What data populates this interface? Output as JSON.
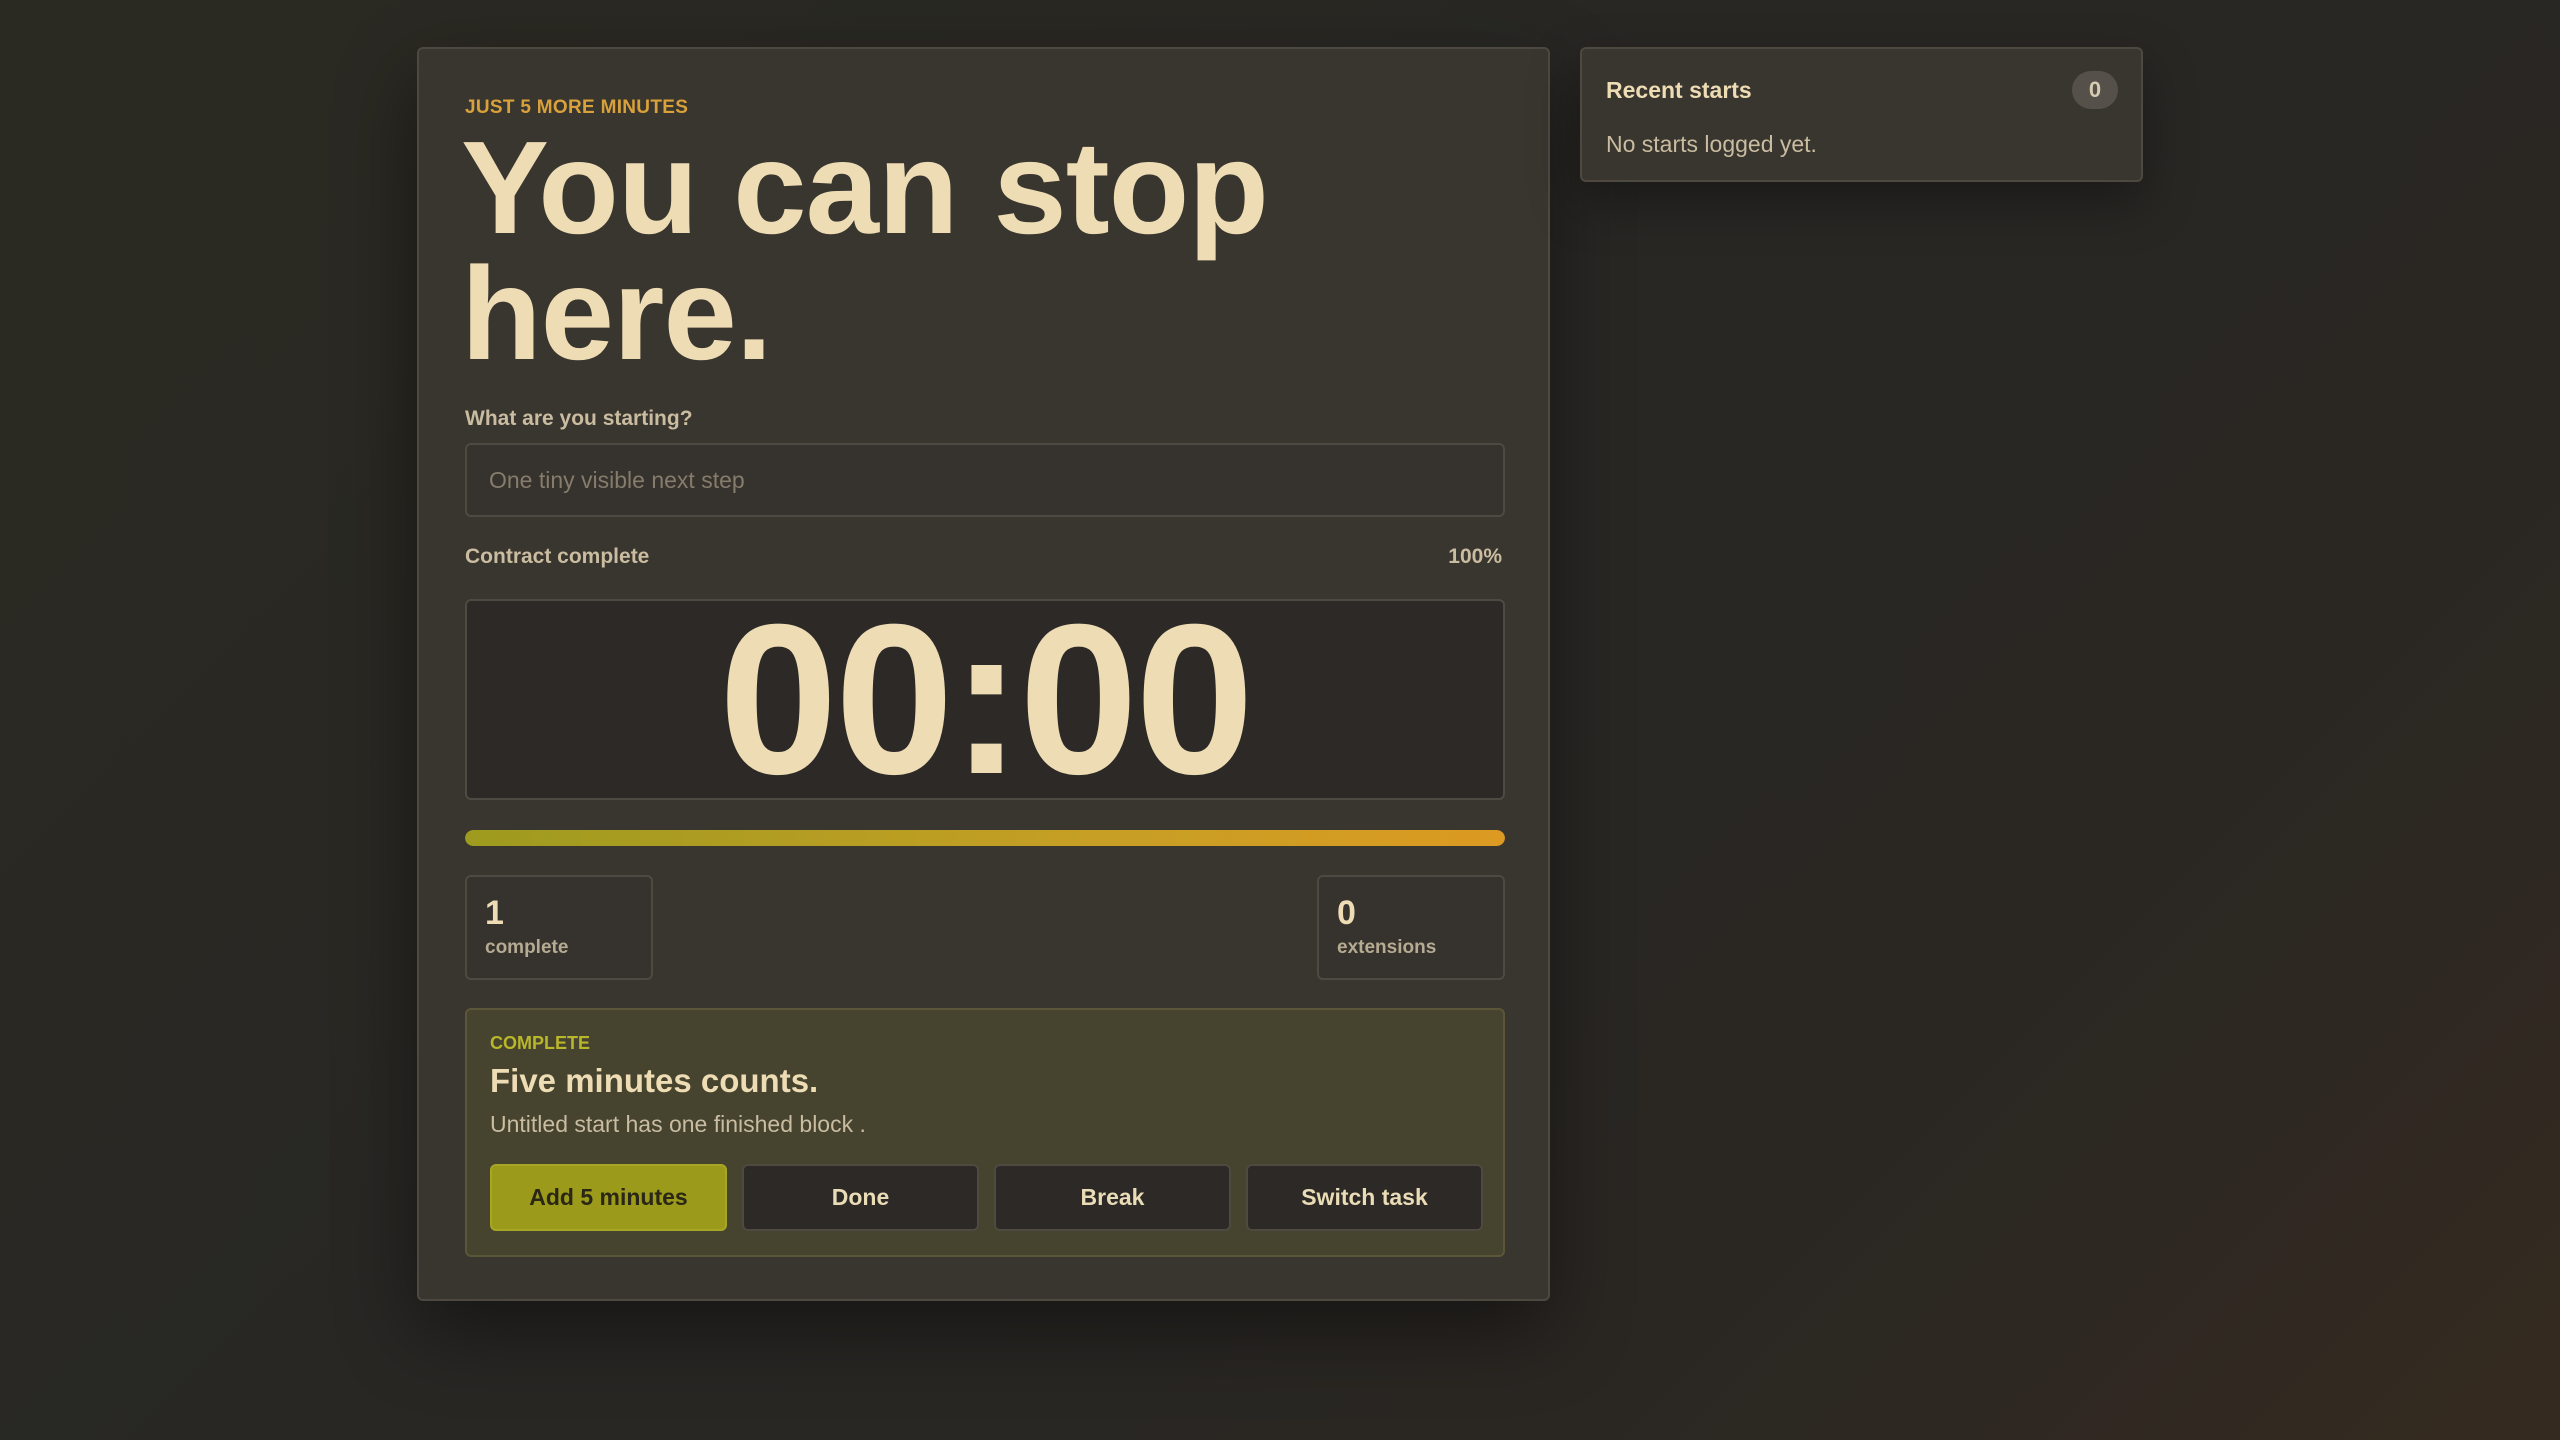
{
  "timer": {
    "eyebrow": "JUST 5 MORE MINUTES",
    "headline": "You can stop here.",
    "task_label": "What are you starting?",
    "task_value": "",
    "task_placeholder": "One tiny visible next step",
    "status_label": "Contract complete",
    "status_percent": "100%",
    "time_display": "00:00",
    "progress_fraction": 1.0
  },
  "stats": {
    "complete_value": "1",
    "complete_label": "complete",
    "extensions_value": "0",
    "extensions_label": "extensions"
  },
  "completion": {
    "eyebrow": "COMPLETE",
    "title": "Five minutes counts.",
    "description": "Untitled start has one finished block .",
    "buttons": {
      "add_five": "Add 5 minutes",
      "done": "Done",
      "break": "Break",
      "switch_task": "Switch task"
    }
  },
  "recent": {
    "title": "Recent starts",
    "count": "0",
    "empty_text": "No starts logged yet."
  },
  "colors": {
    "accent_amber": "#d9a13a",
    "accent_olive": "#9b9a1a",
    "text_cream": "#eddcb4"
  }
}
